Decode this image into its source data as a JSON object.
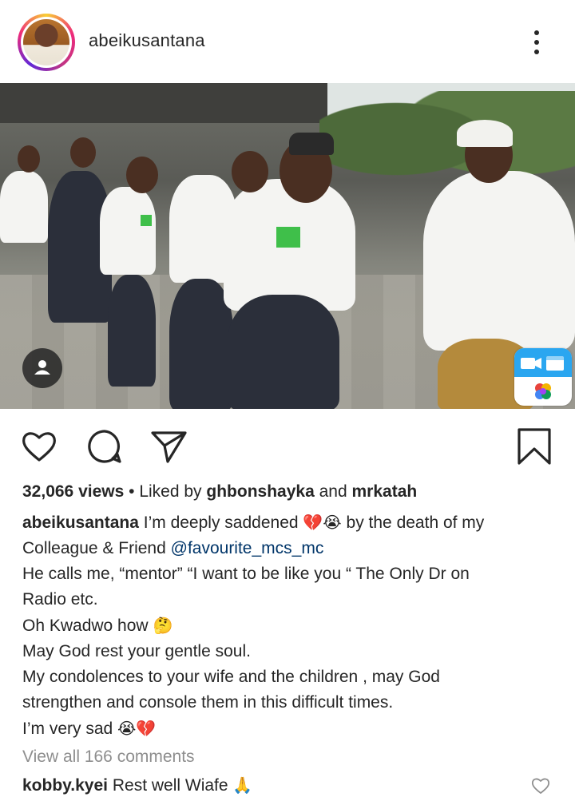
{
  "post": {
    "username": "abeikusantana",
    "views": "32,066 views",
    "liked_by_prefix": "Liked by",
    "liked_by_1": "ghbonshayka",
    "liked_by_and": "and",
    "liked_by_2": "mrkatah",
    "caption_user": "abeikusantana",
    "caption_line1_a": "I’m deeply saddened",
    "caption_line1_emoji": "💔😭",
    "caption_line1_b": "by the death of my",
    "caption_line2_a": "Colleague & Friend",
    "caption_mention": "@favourite_mcs_mc",
    "caption_line3": "He calls me, “mentor” “I want to be like you “ The Only Dr on",
    "caption_line4": "Radio etc.",
    "caption_line5": "Oh Kwadwo how",
    "caption_line5_emoji": "🤔",
    "caption_line6": "May God rest your gentle soul.",
    "caption_line7": "My condolences to your wife and the children , may God",
    "caption_line8": "strengthen and console them in this difficult times.",
    "caption_line9": "I’m very sad",
    "caption_line9_emoji": "😭💔",
    "view_all_comments": "View all 166 comments",
    "comment_user": "kobby.kyei",
    "comment_text": "Rest well Wiafe",
    "comment_emoji": "🙏"
  },
  "icons": {
    "more": "more-vertical-icon",
    "like": "heart-icon",
    "comment": "comment-icon",
    "share": "send-icon",
    "save": "bookmark-icon",
    "tagged": "user-tag-icon",
    "app": "video-editor-app-icon"
  },
  "colors": {
    "text": "#262626",
    "muted": "#8e8e8e",
    "mention": "#003569",
    "story_ring_start": "#f9ce34",
    "story_ring_mid": "#ee2a7b",
    "story_ring_end": "#6228d7"
  }
}
